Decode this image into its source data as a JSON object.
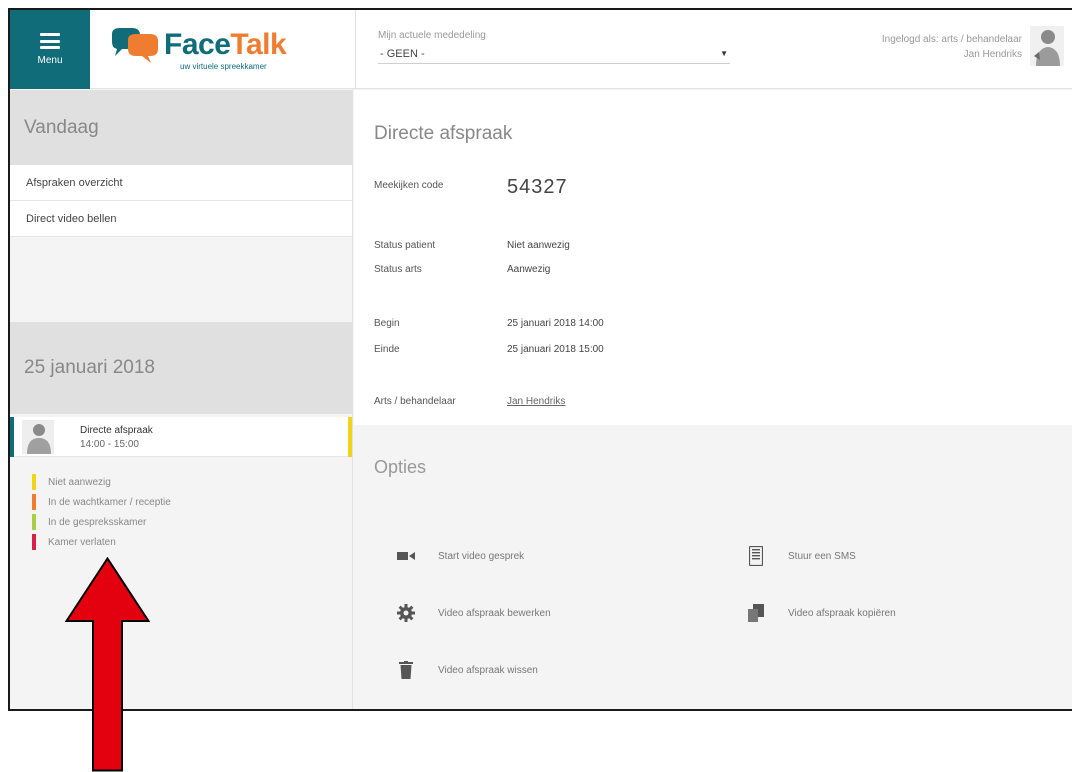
{
  "menu": {
    "label": "Menu"
  },
  "brand": {
    "face": "Face",
    "talk": "Talk",
    "tagline": "uw virtuele spreekkamer"
  },
  "notice": {
    "label": "Mijn actuele mededeling",
    "selected": "- GEEN -"
  },
  "user": {
    "line1": "Ingelogd als: arts / behandelaar",
    "line2": "Jan Hendriks"
  },
  "sidebar": {
    "today": "Vandaag",
    "links": [
      "Afspraken overzicht",
      "Direct video bellen"
    ],
    "date_heading": "25 januari 2018",
    "appointment": {
      "title": "Directe afspraak",
      "time": "14:00 - 15:00"
    },
    "legend": [
      {
        "label": "Niet aanwezig",
        "color": "#f2d31b"
      },
      {
        "label": "In de wachtkamer / receptie",
        "color": "#ef7d31"
      },
      {
        "label": "In de gespreksskamer",
        "color": "#a8cf45"
      },
      {
        "label": "Kamer verlaten",
        "color": "#d6224a"
      }
    ]
  },
  "detail": {
    "title": "Directe afspraak",
    "code_label": "Meekijken code",
    "code": "54327",
    "status_patient_label": "Status patient",
    "status_patient": "Niet aanwezig",
    "status_arts_label": "Status arts",
    "status_arts": "Aanwezig",
    "begin_label": "Begin",
    "begin": "25 januari 2018 14:00",
    "end_label": "Einde",
    "end": "25 januari 2018 15:00",
    "arts_label": "Arts / behandelaar",
    "arts": "Jan Hendriks"
  },
  "options": {
    "title": "Opties",
    "start_video": "Start video gesprek",
    "sms": "Stuur een SMS",
    "edit": "Video afspraak bewerken",
    "copy": "Video afspraak kopiëren",
    "delete": "Video afspraak wissen"
  },
  "colors": {
    "teal": "#0f6c78",
    "orange": "#ef7d31",
    "annotation_red": "#e3000f"
  },
  "icons": [
    "menu-icon",
    "brand-logo-icon",
    "caret-down-icon",
    "video-camera-icon",
    "phone-sms-icon",
    "gear-icon",
    "copy-icon",
    "trash-icon",
    "red-arrow-icon"
  ]
}
